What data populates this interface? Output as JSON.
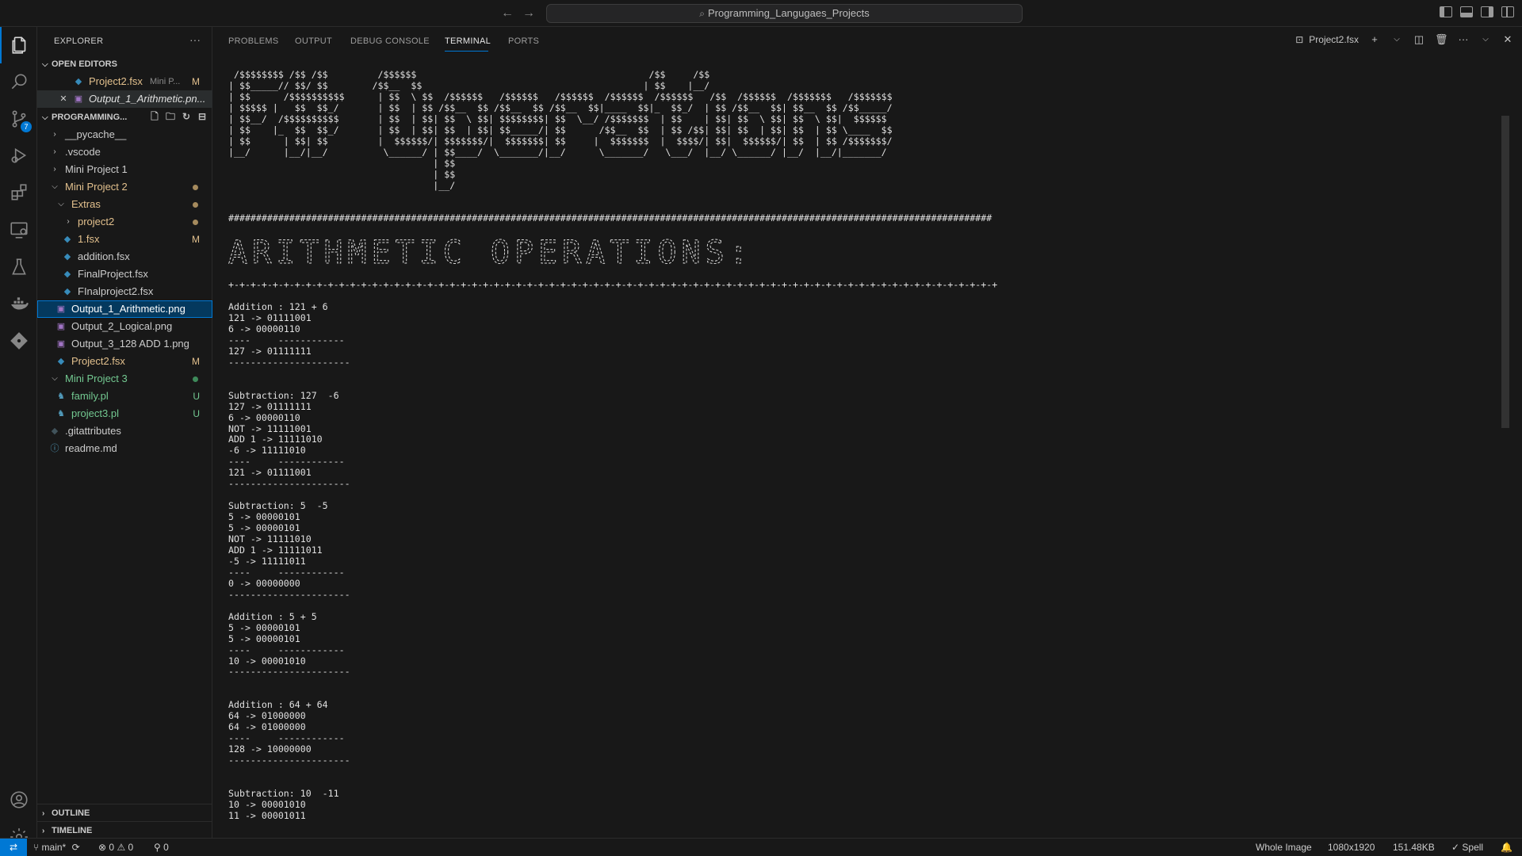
{
  "titlebar": {
    "back_icon": "arrow-left-icon",
    "forward_icon": "arrow-right-icon",
    "search_text": "Programming_Langugaes_Projects"
  },
  "activity": {
    "scm_badge": "7"
  },
  "explorer": {
    "title": "EXPLORER",
    "more": "···",
    "open_editors_label": "OPEN EDITORS",
    "open_editors": [
      {
        "name": "Project2.fsx",
        "desc": "Mini P...",
        "mark": "M"
      },
      {
        "name": "Output_1_Arithmetic.pn..."
      }
    ],
    "project_label": "PROGRAMMING...",
    "tree": {
      "pycache": "__pycache__",
      "vscode": ".vscode",
      "mp1": "Mini Project 1",
      "mp2": "Mini Project 2",
      "extras": "Extras",
      "project2": "project2",
      "f1": "1.fsx",
      "f1_mark": "M",
      "addition": "addition.fsx",
      "finalproject": "FinalProject.fsx",
      "finalproject2": "FInalproject2.fsx",
      "out1": "Output_1_Arithmetic.png",
      "out2": "Output_2_Logical.png",
      "out3": "Output_3_128 ADD 1.png",
      "proj2fsx": "Project2.fsx",
      "proj2fsx_mark": "M",
      "mp3": "Mini Project 3",
      "family": "family.pl",
      "family_mark": "U",
      "project3": "project3.pl",
      "project3_mark": "U",
      "gitattributes": ".gitattributes",
      "readme": "readme.md"
    },
    "outline_label": "OUTLINE",
    "timeline_label": "TIMELINE"
  },
  "panel": {
    "tabs": [
      "PROBLEMS",
      "OUTPUT",
      "DEBUG CONSOLE",
      "TERMINAL",
      "PORTS"
    ],
    "active_tab": "TERMINAL",
    "terminal_name": "Project2.fsx"
  },
  "terminal_output": " /$$$$$$$$ /$$ /$$         /$$$$$$                                          /$$     /$$\n| $$_____// $$/ $$        /$$__  $$                                        | $$    |__/\n| $$      /$$$$$$$$$$      | $$  \\ $$  /$$$$$$   /$$$$$$   /$$$$$$  /$$$$$$  /$$$$$$   /$$  /$$$$$$  /$$$$$$$   /$$$$$$$\n| $$$$$ |   $$  $$_/       | $$  | $$ /$$__  $$ /$$__  $$ /$$__  $$|____  $$|_  $$_/  | $$ /$$__  $$| $$__  $$ /$$_____/\n| $$__/  /$$$$$$$$$$       | $$  | $$| $$  \\ $$| $$$$$$$$| $$  \\__/ /$$$$$$$  | $$    | $$| $$  \\ $$| $$  \\ $$|  $$$$$$\n| $$    |_  $$  $$_/       | $$  | $$| $$  | $$| $$_____/| $$      /$$__  $$  | $$ /$$| $$| $$  | $$| $$  | $$ \\____  $$\n| $$      | $$| $$         |  $$$$$$/| $$$$$$$/|  $$$$$$$| $$     |  $$$$$$$  |  $$$$/| $$|  $$$$$$/| $$  | $$ /$$$$$$$/\n|__/      |__/|__/          \\______/ | $$____/  \\_______/|__/      \\_______/   \\___/  |__/ \\______/ |__/  |__/|_______/\n                                     | $$\n                                     | $$\n                                     |__/\n\n\n##########################################################################################################################################\n\n\n\n\n\n+-+-+-+-+-+-+-+-+-+-+-+-+-+-+-+-+-+-+-+-+-+-+-+-+-+-+-+-+-+-+-+-+-+-+-+-+-+-+-+-+-+-+-+-+-+-+-+-+-+-+-+-+-+-+-+-+-+-+-+-+-+-+-+-+-+-+-+-+-+\n\nAddition : 121 + 6\n121 -> 01111001\n6 -> 00000110\n----     ------------\n127 -> 01111111\n----------------------\n\n\nSubtraction: 127  -6\n127 -> 01111111\n6 -> 00000110\nNOT -> 11111001\nADD 1 -> 11111010\n-6 -> 11111010\n----     ------------\n121 -> 01111001\n----------------------\n\nSubtraction: 5  -5\n5 -> 00000101\n5 -> 00000101\nNOT -> 11111010\nADD 1 -> 11111011\n-5 -> 11111011\n----     ------------\n0 -> 00000000\n----------------------\n\nAddition : 5 + 5\n5 -> 00000101\n5 -> 00000101\n----     ------------\n10 -> 00001010\n----------------------\n\n\nAddition : 64 + 64\n64 -> 01000000\n64 -> 01000000\n----     ------------\n128 -> 10000000\n----------------------\n\n\nSubtraction: 10  -11\n10 -> 00001010\n11 -> 00001011",
  "banner_heading": "ARITHMETIC OPERATIONS:",
  "status": {
    "branch": "main*",
    "errors": "0",
    "warnings": "0",
    "ports": "0",
    "whole_image": "Whole Image",
    "dimensions": "1080x1920",
    "size": "151.48KB",
    "spell": "Spell"
  },
  "colors": {
    "accent": "#0078d4",
    "modified": "#e2c08d",
    "untracked": "#73c991"
  }
}
